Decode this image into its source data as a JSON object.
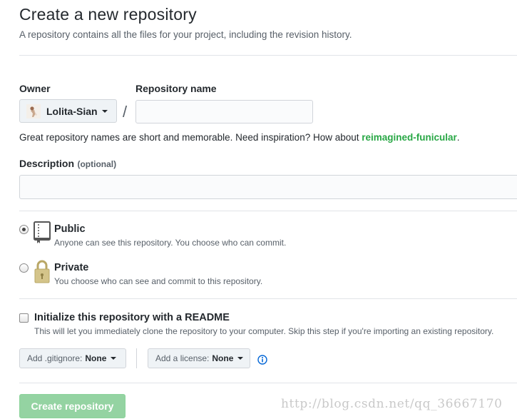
{
  "header": {
    "title": "Create a new repository",
    "subtitle": "A repository contains all the files for your project, including the revision history."
  },
  "owner": {
    "label": "Owner",
    "value": "Lolita-Sian",
    "avatar_icon": "user-avatar"
  },
  "separator": "/",
  "repo_name": {
    "label": "Repository name",
    "value": "",
    "placeholder": ""
  },
  "hint": {
    "text": "Great repository names are short and memorable. Need inspiration? How about ",
    "suggestion": "reimagined-funicular",
    "suffix": "."
  },
  "description": {
    "label": "Description",
    "optional": "(optional)",
    "value": ""
  },
  "visibility": {
    "selected": "public",
    "public": {
      "title": "Public",
      "note": "Anyone can see this repository. You choose who can commit.",
      "icon": "repo-book-icon"
    },
    "private": {
      "title": "Private",
      "note": "You choose who can see and commit to this repository.",
      "icon": "lock-icon"
    }
  },
  "readme": {
    "title": "Initialize this repository with a README",
    "note": "This will let you immediately clone the repository to your computer. Skip this step if you're importing an existing repository.",
    "checked": false
  },
  "gitignore": {
    "prefix": "Add .gitignore:",
    "value": "None"
  },
  "license": {
    "prefix": "Add a license:",
    "value": "None"
  },
  "info_icon": "info-icon",
  "submit": {
    "label": "Create repository",
    "disabled": true
  },
  "watermark": "http://blog.csdn.net/qq_36667170",
  "colors": {
    "suggestion": "#28a745",
    "submit_bg": "#94d3a2",
    "info": "#0366d6",
    "lock": "#b9a766"
  }
}
